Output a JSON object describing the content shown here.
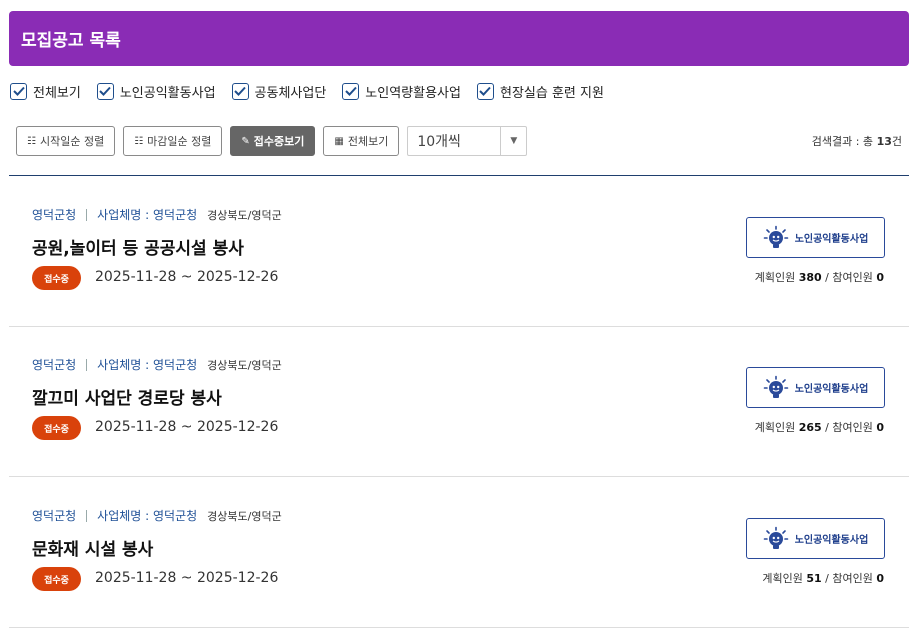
{
  "header": {
    "title": "모집공고 목록"
  },
  "filters": [
    {
      "label": "전체보기",
      "checked": true
    },
    {
      "label": "노인공익활동사업",
      "checked": true
    },
    {
      "label": "공동체사업단",
      "checked": true
    },
    {
      "label": "노인역량활용사업",
      "checked": true
    },
    {
      "label": "현장실습 훈련 지원",
      "checked": true
    }
  ],
  "toolbar": {
    "sort_start_label": "시작일순 정렬",
    "sort_end_label": "마감일순 정렬",
    "receiving_label": "접수중보기",
    "all_label": "전체보기",
    "page_size_value": "10개씩",
    "result_prefix": "검색결과 : 총",
    "result_count": "13",
    "result_suffix": "건"
  },
  "colors": {
    "header": "#8a2cb5",
    "status": "#d9420b",
    "link": "#1f5096"
  },
  "postings": [
    {
      "org": "영덕군청",
      "company": "사업체명 : 영덕군청",
      "region": "경상북도/영덕군",
      "title": "공원,놀이터 등 공공시설 봉사",
      "status": "접수중",
      "period": "2025-11-28 ~ 2025-12-26",
      "business": "노인공익활동사업",
      "planned_label": "계획인원",
      "planned": "380",
      "participants_label": "참여인원",
      "participants": "0"
    },
    {
      "org": "영덕군청",
      "company": "사업체명 : 영덕군청",
      "region": "경상북도/영덕군",
      "title": "깔끄미 사업단 경로당 봉사",
      "status": "접수중",
      "period": "2025-11-28 ~ 2025-12-26",
      "business": "노인공익활동사업",
      "planned_label": "계획인원",
      "planned": "265",
      "participants_label": "참여인원",
      "participants": "0"
    },
    {
      "org": "영덕군청",
      "company": "사업체명 : 영덕군청",
      "region": "경상북도/영덕군",
      "title": "문화재 시설 봉사",
      "status": "접수중",
      "period": "2025-11-28 ~ 2025-12-26",
      "business": "노인공익활동사업",
      "planned_label": "계획인원",
      "planned": "51",
      "participants_label": "참여인원",
      "participants": "0"
    }
  ]
}
